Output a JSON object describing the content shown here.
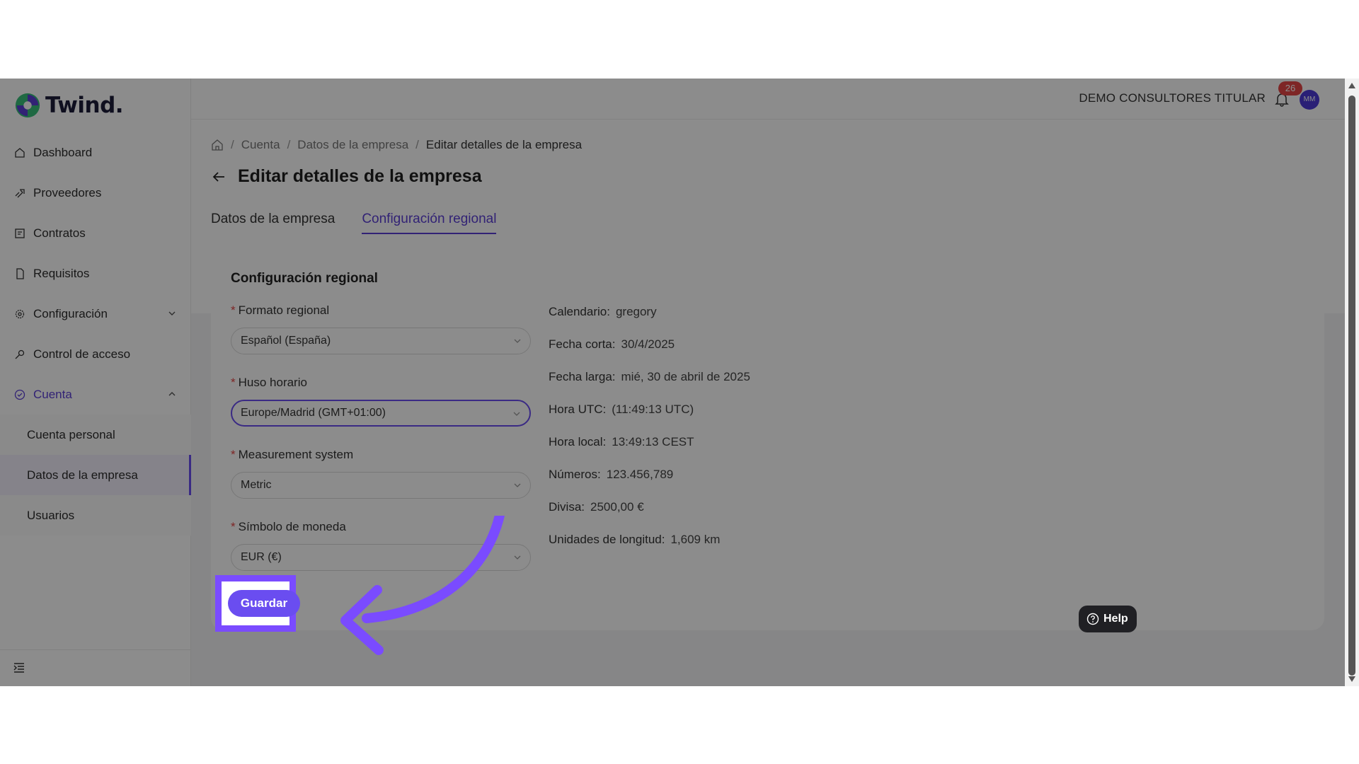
{
  "app": {
    "logo_text": "Twind."
  },
  "sidebar": {
    "items": [
      {
        "label": "Dashboard",
        "icon": "home-icon"
      },
      {
        "label": "Proveedores",
        "icon": "handshake-icon"
      },
      {
        "label": "Contratos",
        "icon": "contract-icon"
      },
      {
        "label": "Requisitos",
        "icon": "document-icon"
      },
      {
        "label": "Configuración",
        "icon": "gear-icon"
      },
      {
        "label": "Control de acceso",
        "icon": "key-icon"
      },
      {
        "label": "Cuenta",
        "icon": "account-icon"
      }
    ],
    "sub_items": [
      {
        "label": "Cuenta personal"
      },
      {
        "label": "Datos de la empresa"
      },
      {
        "label": "Usuarios"
      }
    ]
  },
  "topbar": {
    "company": "DEMO CONSULTORES TITULAR",
    "notifications": "26",
    "avatar": "MM"
  },
  "breadcrumb": [
    "Cuenta",
    "Datos de la empresa",
    "Editar detalles de la empresa"
  ],
  "page": {
    "title": "Editar detalles de la empresa"
  },
  "tabs": [
    {
      "label": "Datos de la empresa"
    },
    {
      "label": "Configuración regional"
    }
  ],
  "card": {
    "title": "Configuración regional",
    "fields": [
      {
        "label": "Formato regional",
        "value": "Español (España)"
      },
      {
        "label": "Huso horario",
        "value": "Europe/Madrid (GMT+01:00)"
      },
      {
        "label": "Measurement system",
        "value": "Metric"
      },
      {
        "label": "Símbolo de moneda",
        "value": "EUR (€)"
      }
    ],
    "info": [
      {
        "key": "Calendario:",
        "value": "gregory"
      },
      {
        "key": "Fecha corta:",
        "value": "30/4/2025"
      },
      {
        "key": "Fecha larga:",
        "value": "mié, 30 de abril de 2025"
      },
      {
        "key": "Hora UTC:",
        "value": "(11:49:13 UTC)"
      },
      {
        "key": "Hora local:",
        "value": "13:49:13 CEST"
      },
      {
        "key": "Números:",
        "value": "123.456,789"
      },
      {
        "key": "Divisa:",
        "value": "2500,00 €"
      },
      {
        "key": "Unidades de longitud:",
        "value": "1,609 km"
      }
    ],
    "save_label": "Guardar"
  },
  "help": {
    "label": "Help"
  },
  "colors": {
    "accent": "#6a4df0",
    "highlight": "#7a4bff",
    "badge": "#e54545"
  }
}
